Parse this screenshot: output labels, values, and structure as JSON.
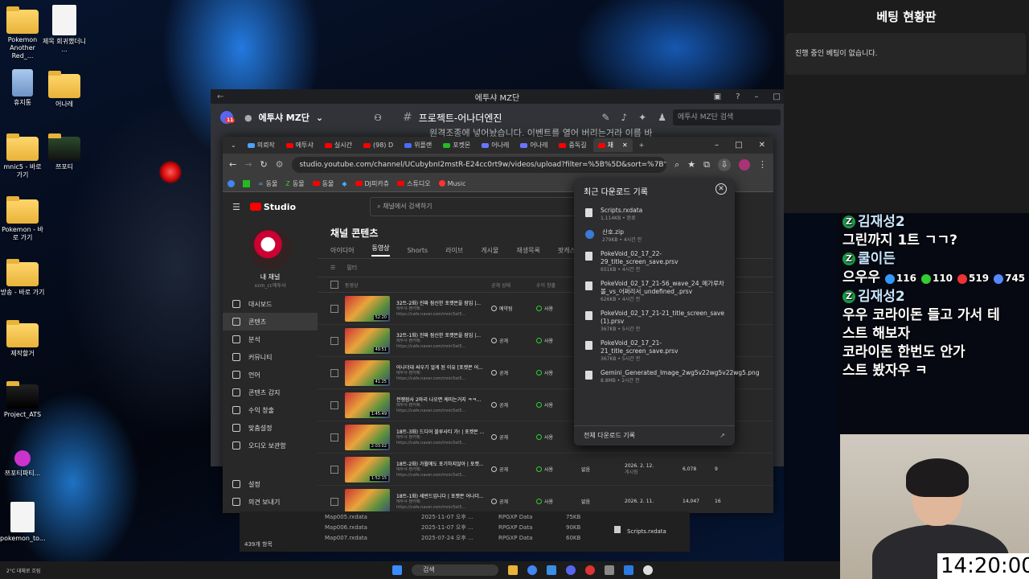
{
  "desktop": {
    "icons": [
      {
        "label": "Pokemon Another Red_...",
        "kind": "folder"
      },
      {
        "label": "제목 회귀했더니 ...",
        "kind": "doc"
      },
      {
        "label": "휴지통",
        "kind": "bin"
      },
      {
        "label": "어나레",
        "kind": "folder"
      },
      {
        "label": "mnic5 - 바로 가기",
        "kind": "folder"
      },
      {
        "label": "쯔포티",
        "kind": "folder"
      },
      {
        "label": "Pokemon - 바로 가기",
        "kind": "folder"
      },
      {
        "label": "방송 - 바로 가기",
        "kind": "folder"
      },
      {
        "label": "제작할거",
        "kind": "folder"
      },
      {
        "label": "Project_ATS",
        "kind": "folder"
      },
      {
        "label": "쯔포티파티...",
        "kind": "app"
      },
      {
        "label": "pokemon_to...",
        "kind": "doc"
      }
    ]
  },
  "discord": {
    "window_title": "에투샤 MZ단",
    "server_name": "에투샤 MZ단",
    "badge": "11",
    "channel_name": "프로젝트-어나더엔진",
    "search_placeholder": "에투샤 MZ단 검색",
    "message_preview": "원격조종에 넣어놨습니다. 이벤트를 열어 버리는거라 이름 바"
  },
  "chrome": {
    "tabs": [
      "의뢰작",
      "에투샤",
      "실시간",
      "(98) D",
      "위플랜",
      "포켓몬",
      "어나레",
      "어나레",
      "중독길",
      "채"
    ],
    "url": "studio.youtube.com/channel/UCubybnI2mstR-E24cc0rt9w/videos/upload?filter=%5B%5D&sort=%7B\"colu...",
    "bookmarks": [
      "동물",
      "동물",
      "동물",
      "DJ피카츄",
      "스튜디오",
      "Music"
    ]
  },
  "studio": {
    "logo": "Studio",
    "search_placeholder": "채널에서 검색하기",
    "channel_label": "내 채널",
    "channel_sub": "xxm_cc에투샤",
    "nav": [
      "대시보드",
      "콘텐츠",
      "분석",
      "커뮤니티",
      "언어",
      "콘텐츠 감지",
      "수익 창출",
      "맞춤설정",
      "오디오 보관함"
    ],
    "bottom_nav": [
      "설정",
      "의견 보내기"
    ],
    "title": "채널 콘텐츠",
    "tabs": [
      "아이디어",
      "동영상",
      "Shorts",
      "라이브",
      "게시물",
      "재생목록",
      "팟캐스트"
    ],
    "filter_label": "필터",
    "col_video": "동영상",
    "col_visibility": "공개 상태",
    "col_restrictions": "수익 창출",
    "rows": [
      {
        "title": "32트-2화) 진짜 잠신한 포켓몬을 잠입 |...",
        "desc": "에투샤 팬카페:",
        "link": "https://cafe.naver.com/mnic5et5...",
        "dur": "52:20",
        "vis": "예약됨",
        "res": "사용",
        "extra": "",
        "date": "",
        "date_sub": "",
        "views": "",
        "comments": ""
      },
      {
        "title": "32트-1화) 진짜 잠신한 포켓몬을 잠입 |...",
        "desc": "에투샤 팬카페:",
        "link": "https://cafe.naver.com/mnic5et5...",
        "dur": "49:51",
        "vis": "공개",
        "res": "사용",
        "extra": "",
        "date": "",
        "date_sub": "",
        "views": "",
        "comments": ""
      },
      {
        "title": "어나더대 싸우기 얼게 된 이유 [포켓몬 어...",
        "desc": "에투샤 팬카페:",
        "link": "https://cafe.naver.com/mnic5et5...",
        "dur": "41:25",
        "vis": "공개",
        "res": "사용",
        "extra": "",
        "date": "",
        "date_sub": "",
        "views": "",
        "comments": ""
      },
      {
        "title": "전쟁장사 2마리 나오면 케미는거지 ㅋㅋ...",
        "desc": "에투샤 팬카페:",
        "link": "https://cafe.naver.com/mnic5et5...",
        "dur": "1:45:49",
        "vis": "공개",
        "res": "사용",
        "extra": "",
        "date": "",
        "date_sub": "",
        "views": "",
        "comments": ""
      },
      {
        "title": "18트-3화) 드디어 블루사티 가! | 포켓몬 ...",
        "desc": "에투샤 팬카페:",
        "link": "https://cafe.naver.com/mnic5et5...",
        "dur": "2:03:02",
        "vis": "공개",
        "res": "사용",
        "extra": "",
        "date": "",
        "date_sub": "",
        "views": "",
        "comments": ""
      },
      {
        "title": "18트-2화) 가월에도 포기하지않아 | 포켓...",
        "desc": "에투샤 팬카페:",
        "link": "https://cafe.naver.com/mnic5et5...",
        "dur": "1:52:15",
        "vis": "공개",
        "res": "사용",
        "extra": "없음",
        "date": "2026. 2. 12.",
        "date_sub": "게시됨",
        "views": "6,078",
        "comments": "9"
      },
      {
        "title": "18트-1화) 세번드입니다 | 포켓몬 어나더...",
        "desc": "에투샤 팬카페:",
        "link": "https://cafe.naver.com/mnic5et5...",
        "dur": "",
        "vis": "공개",
        "res": "사용",
        "extra": "없음",
        "date": "2026. 2. 11.",
        "date_sub": "",
        "views": "14,047",
        "comments": "16"
      }
    ]
  },
  "downloads": {
    "title": "최근 다운로드 기록",
    "items": [
      {
        "name": "Scripts.rxdata",
        "meta": "1,114KB • 완료",
        "kind": "file"
      },
      {
        "name": "산호.zip",
        "meta": "279KB • 4시간 전",
        "kind": "zip"
      },
      {
        "name": "PokeVoid_02_17_22-29_title_screen_save.prsv",
        "meta": "651KB • 4시간 전",
        "kind": "file"
      },
      {
        "name": "PokeVoid_02_17_21-56_wave_24_메가루차볼_vs_어쩌리서_undefined_.prsv",
        "meta": "626KB • 4시간 전",
        "kind": "file"
      },
      {
        "name": "PokeVoid_02_17_21-21_title_screen_save (1).prsv",
        "meta": "367KB • 5시간 전",
        "kind": "file"
      },
      {
        "name": "PokeVoid_02_17_21-21_title_screen_save.prsv",
        "meta": "367KB • 5시간 전",
        "kind": "file"
      },
      {
        "name": "Gemini_Generated_Image_2wg5v22wg5v22wg5.png",
        "meta": "8.8MB • 2시간 전",
        "kind": "file"
      }
    ],
    "footer": "전체 다운로드 기록"
  },
  "explorer": {
    "rows": [
      {
        "name": "Map005.rxdata",
        "date": "2025-11-07 오후 ...",
        "type": "RPGXP Data",
        "size": "75KB"
      },
      {
        "name": "Map006.rxdata",
        "date": "2025-11-07 오후 ...",
        "type": "RPGXP Data",
        "size": "90KB"
      },
      {
        "name": "Map007.rxdata",
        "date": "2025-07-24 오후 ...",
        "type": "RPGXP Data",
        "size": "60KB"
      }
    ],
    "count": "439개 항목",
    "selected": "Scripts.rxdata"
  },
  "taskbar": {
    "weather": "2°C 대체로 흐림",
    "search": "검색"
  },
  "betting": {
    "title": "베팅 현황판",
    "empty": "진행 중인 베팅이 없습니다."
  },
  "chat": {
    "lines": [
      {
        "name": "김재성2",
        "text": ""
      },
      {
        "name": "",
        "text": "그린까지 1트 ㄱㄱ?"
      },
      {
        "name": "쿨이든",
        "text": ""
      },
      {
        "name": "",
        "text": "으우우"
      },
      {
        "name": "김재성2",
        "text": ""
      },
      {
        "name": "",
        "text": "우우 코라이돈 들고 가서 테"
      },
      {
        "name": "",
        "text": "스트 해보자"
      },
      {
        "name": "",
        "text": "코라이돈 한번도 안가"
      },
      {
        "name": "",
        "text": "스트 봤자우 ㅋ"
      }
    ],
    "emotes": [
      "116",
      "110",
      "519",
      "745"
    ]
  },
  "clock": "14:20:00"
}
